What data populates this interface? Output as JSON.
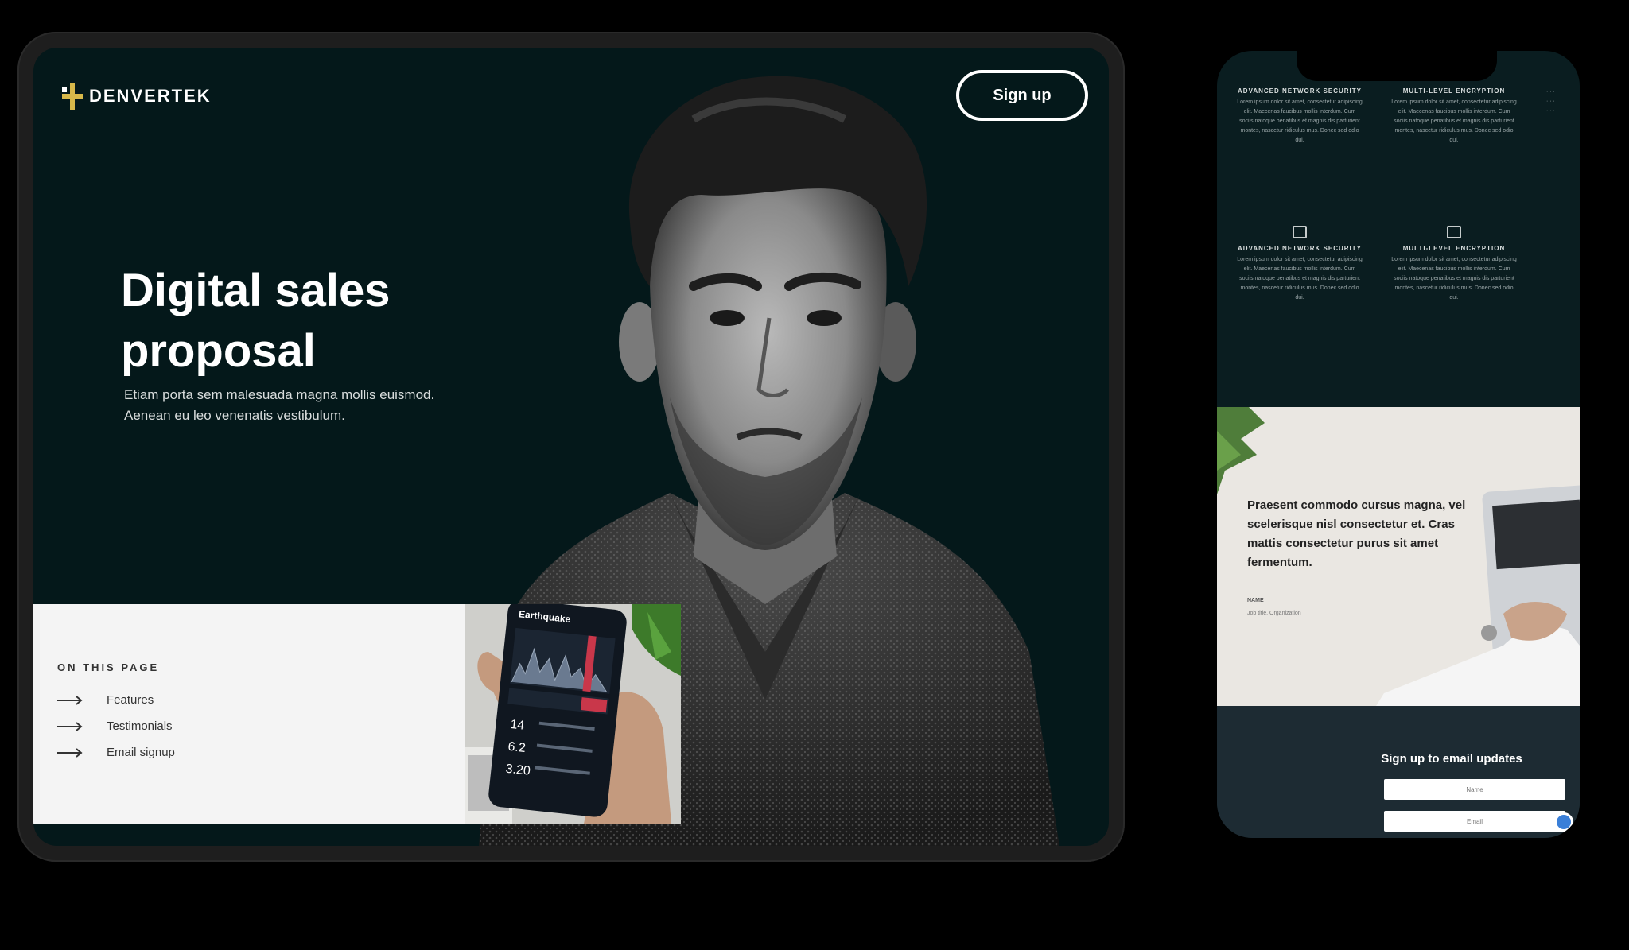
{
  "tablet": {
    "brand": "DENVERTEK",
    "signup_label": "Sign up",
    "hero": {
      "title": "Digital sales proposal",
      "subtitle": "Etiam porta sem malesuada magna mollis euismod. Aenean eu leo venenatis vestibulum."
    },
    "toc": {
      "title": "ON THIS PAGE",
      "items": [
        {
          "label": "Features"
        },
        {
          "label": "Testimonials"
        },
        {
          "label": "Email signup"
        }
      ]
    },
    "phone_app": {
      "title": "Earthquake",
      "stats": [
        "14",
        "6.2",
        "3.20"
      ]
    }
  },
  "phone": {
    "features": [
      {
        "title": "ADVANCED NETWORK SECURITY",
        "body": "Lorem ipsum dolor sit amet, consectetur adipiscing elit. Maecenas faucibus mollis interdum. Cum sociis natoque penatibus et magnis dis parturient montes, nascetur ridiculus mus. Donec sed odio dui."
      },
      {
        "title": "MULTI-LEVEL ENCRYPTION",
        "body": "Lorem ipsum dolor sit amet, consectetur adipiscing elit. Maecenas faucibus mollis interdum. Cum sociis natoque penatibus et magnis dis parturient montes, nascetur ridiculus mus. Donec sed odio dui."
      },
      {
        "title": "ADVANCED NETWORK SECURITY",
        "body": "Lorem ipsum dolor sit amet, consectetur adipiscing elit. Maecenas faucibus mollis interdum. Cum sociis natoque penatibus et magnis dis parturient montes, nascetur ridiculus mus. Donec sed odio dui."
      },
      {
        "title": "MULTI-LEVEL ENCRYPTION",
        "body": "Lorem ipsum dolor sit amet, consectetur adipiscing elit. Maecenas faucibus mollis interdum. Cum sociis natoque penatibus et magnis dis parturient montes, nascetur ridiculus mus. Donec sed odio dui."
      }
    ],
    "testimonial": {
      "quote": "Praesent commodo cursus magna, vel scelerisque nisl consectetur et. Cras mattis consectetur purus sit amet fermentum.",
      "name": "NAME",
      "role": "Job title, Organization"
    },
    "email": {
      "title": "Sign up to email updates",
      "name_placeholder": "Name",
      "email_placeholder": "Email"
    }
  },
  "colors": {
    "background": "#000000",
    "hero_bg": "#04181a",
    "accent": "#d7b84a",
    "toc_bg": "#f4f4f4",
    "email_bg": "#1d2b33"
  }
}
